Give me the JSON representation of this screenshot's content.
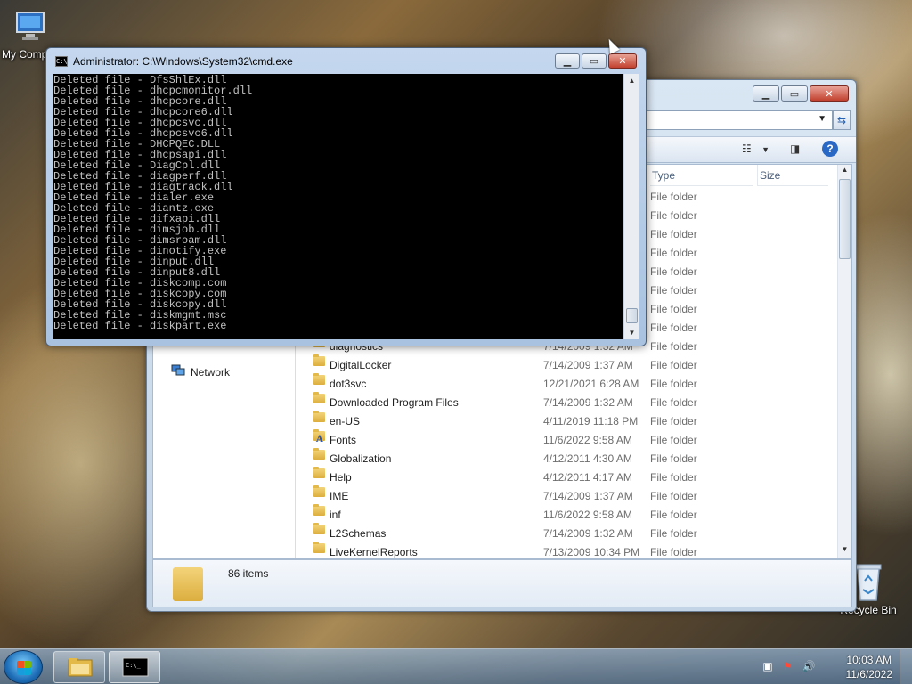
{
  "desktop": {
    "icons": [
      {
        "label": "My Comp",
        "icon": "computer-icon"
      },
      {
        "label": "Recycle Bin",
        "icon": "recycle-bin-icon"
      }
    ]
  },
  "explorer": {
    "nav_items": [
      {
        "label": "Network",
        "icon": "network-icon"
      }
    ],
    "columns": {
      "type": "Type",
      "size": "Size"
    },
    "partial_rows": [
      {
        "type": "File folder"
      },
      {
        "type": "File folder"
      },
      {
        "type": "File folder"
      },
      {
        "type": "File folder"
      },
      {
        "type": "File folder"
      },
      {
        "type": "File folder"
      },
      {
        "type": "File folder"
      },
      {
        "type": "File folder"
      }
    ],
    "rows": [
      {
        "name": "diagnostics",
        "date": "7/14/2009 1:32 AM",
        "type": "File folder"
      },
      {
        "name": "DigitalLocker",
        "date": "7/14/2009 1:37 AM",
        "type": "File folder"
      },
      {
        "name": "dot3svc",
        "date": "12/21/2021 6:28 AM",
        "type": "File folder"
      },
      {
        "name": "Downloaded Program Files",
        "date": "7/14/2009 1:32 AM",
        "type": "File folder"
      },
      {
        "name": "en-US",
        "date": "4/11/2019 11:18 PM",
        "type": "File folder"
      },
      {
        "name": "Fonts",
        "date": "11/6/2022 9:58 AM",
        "type": "File folder"
      },
      {
        "name": "Globalization",
        "date": "4/12/2011 4:30 AM",
        "type": "File folder"
      },
      {
        "name": "Help",
        "date": "4/12/2011 4:17 AM",
        "type": "File folder"
      },
      {
        "name": "IME",
        "date": "7/14/2009 1:37 AM",
        "type": "File folder"
      },
      {
        "name": "inf",
        "date": "11/6/2022 9:58 AM",
        "type": "File folder"
      },
      {
        "name": "L2Schemas",
        "date": "7/14/2009 1:32 AM",
        "type": "File folder"
      },
      {
        "name": "LiveKernelReports",
        "date": "7/13/2009 10:34 PM",
        "type": "File folder"
      }
    ],
    "status": {
      "items": "86 items"
    }
  },
  "cmd": {
    "title": "Administrator:  C:\\Windows\\System32\\cmd.exe",
    "lines": [
      "Deleted file - DfsShlEx.dll",
      "Deleted file - dhcpcmonitor.dll",
      "Deleted file - dhcpcore.dll",
      "Deleted file - dhcpcore6.dll",
      "Deleted file - dhcpcsvc.dll",
      "Deleted file - dhcpcsvc6.dll",
      "Deleted file - DHCPQEC.DLL",
      "Deleted file - dhcpsapi.dll",
      "Deleted file - DiagCpl.dll",
      "Deleted file - diagperf.dll",
      "Deleted file - diagtrack.dll",
      "Deleted file - dialer.exe",
      "Deleted file - diantz.exe",
      "Deleted file - difxapi.dll",
      "Deleted file - dimsjob.dll",
      "Deleted file - dimsroam.dll",
      "Deleted file - dinotify.exe",
      "Deleted file - dinput.dll",
      "Deleted file - dinput8.dll",
      "Deleted file - diskcomp.com",
      "Deleted file - diskcopy.com",
      "Deleted file - diskcopy.dll",
      "Deleted file - diskmgmt.msc",
      "Deleted file - diskpart.exe"
    ]
  },
  "taskbar": {
    "clock_time": "10:03 AM",
    "clock_date": "11/6/2022"
  },
  "colors": {
    "cmd_bg": "#000000",
    "cmd_text": "#c0c0c0",
    "close_red": "#c2412e"
  }
}
